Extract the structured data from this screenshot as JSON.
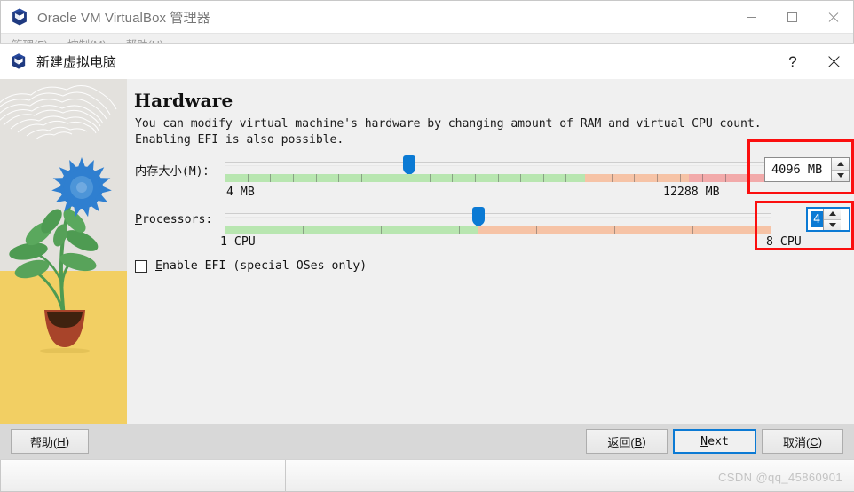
{
  "manager_window": {
    "title": "Oracle VM VirtualBox 管理器",
    "icon": "virtualbox-cube-icon",
    "caption_buttons": [
      {
        "name": "minimize",
        "glyph": "minimize-icon"
      },
      {
        "name": "maximize",
        "glyph": "maximize-icon"
      },
      {
        "name": "close",
        "glyph": "close-icon"
      }
    ],
    "menu_items": [
      "管理(F)",
      "控制(M)",
      "帮助(H)"
    ]
  },
  "dialog": {
    "title": "新建虚拟电脑",
    "icon": "virtualbox-cube-icon",
    "help_button": "?",
    "close_button": "close-icon",
    "illustration": {
      "name": "flower-pot-illustration",
      "sky_color": "#e3e1dd",
      "ground_color": "#f2cf63",
      "flower_color": "#2f7fd0",
      "leaf_color": "#4e9b52",
      "pot_color": "#a8442a"
    },
    "page": {
      "title": "Hardware",
      "description": "You can modify virtual machine's hardware by changing amount of RAM and virtual CPU count. Enabling EFI is also possible.",
      "memory": {
        "label": "内存大小(M)：",
        "label_accel": "M",
        "min_label": "4 MB",
        "max_label": "12288 MB",
        "value_text": "4096 MB",
        "slider_percent": 33.8,
        "scale_segments": [
          {
            "color": "#b8e6b0",
            "width_percent": 66.0
          },
          {
            "color": "#f6c3a6",
            "width_percent": 19.0
          },
          {
            "color": "#f2aaaa",
            "width_percent": 15.0
          }
        ],
        "tick_count": 24
      },
      "processors": {
        "label": "Processors:",
        "label_accel": "P",
        "min_label": "1 CPU",
        "max_label": "8 CPU",
        "value_text": "4",
        "value_selected": true,
        "slider_percent": 46.5,
        "scale_segments": [
          {
            "color": "#b8e6b0",
            "width_percent": 46.5
          },
          {
            "color": "#f6c3a6",
            "width_percent": 53.5
          }
        ],
        "tick_count": 7
      },
      "efi": {
        "label_prefix": "",
        "label_accel": "E",
        "label_rest": "nable EFI (special OSes only)",
        "checked": false
      }
    },
    "footer": {
      "help_button": {
        "prefix": "帮助(",
        "accel": "H",
        "suffix": ")"
      },
      "back_button": {
        "prefix": "返回(",
        "accel": "B",
        "suffix": ")"
      },
      "next_button": {
        "prefix": "",
        "accel": "N",
        "suffix": "ext",
        "focused": true
      },
      "cancel_button": {
        "prefix": "取消(",
        "accel": "C",
        "suffix": ")"
      }
    }
  },
  "annotations": {
    "color": "#fb0f0f",
    "boxes": [
      {
        "name": "memory-spinbox-highlight"
      },
      {
        "name": "cpu-spinbox-highlight"
      }
    ]
  },
  "watermark": "CSDN @qq_45860901"
}
